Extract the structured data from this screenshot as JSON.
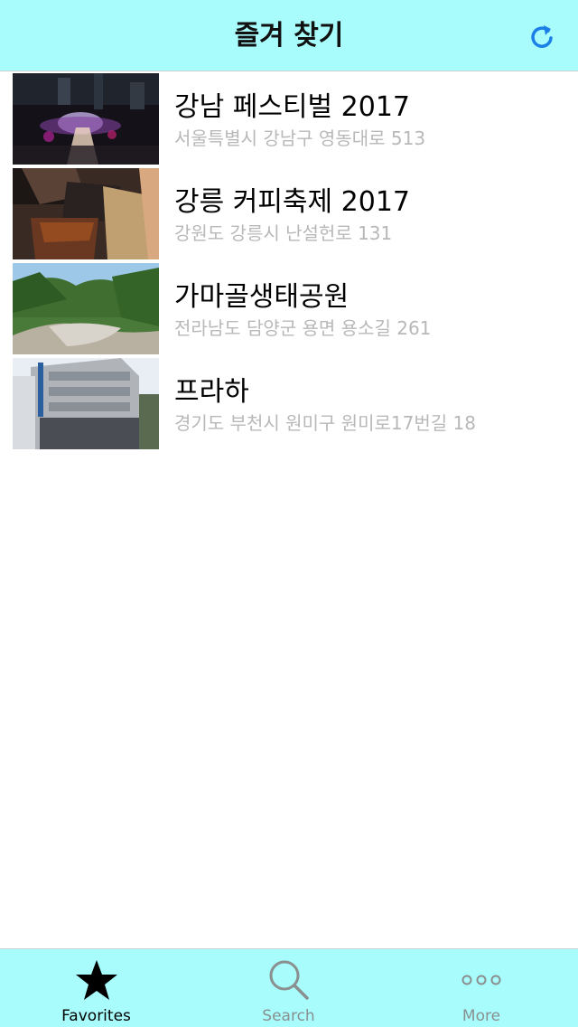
{
  "header": {
    "title": "즐겨 찾기",
    "refresh_icon": "refresh-icon"
  },
  "favorites": [
    {
      "title": "강남 페스티벌 2017",
      "address": "서울특별시 강남구 영동대로 513",
      "thumb": "festival-night-photo"
    },
    {
      "title": "강릉 커피축제 2017",
      "address": "강원도 강릉시 난설헌로 131",
      "thumb": "coffee-pour-photo"
    },
    {
      "title": "가마골생태공원",
      "address": "전라남도 담양군 용면 용소길 261",
      "thumb": "valley-stream-photo"
    },
    {
      "title": "프라하",
      "address": "경기도 부천시 원미구 원미로17번길 18",
      "thumb": "building-street-photo"
    }
  ],
  "tabbar": {
    "tabs": [
      {
        "label": "Favorites",
        "icon": "star-icon",
        "active": true
      },
      {
        "label": "Search",
        "icon": "search-icon",
        "active": false
      },
      {
        "label": "More",
        "icon": "more-icon",
        "active": false
      }
    ]
  },
  "colors": {
    "bar_background": "#a8fcfc",
    "accent": "#1a7fe6",
    "subtitle_gray": "#b8b8b8"
  }
}
